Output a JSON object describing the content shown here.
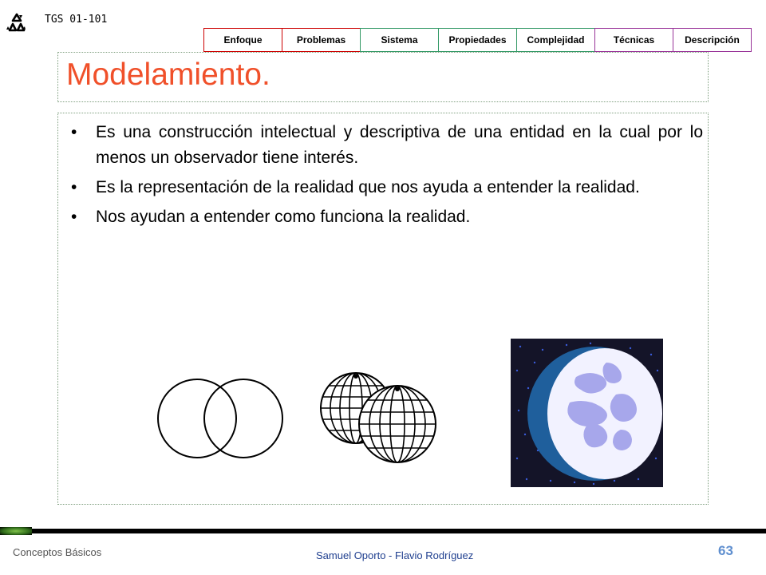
{
  "header": {
    "course": "TGS 01-101",
    "logo_icon": "recycle-icon"
  },
  "nav": {
    "tabs": [
      {
        "label": "Enfoque",
        "color": "#cc0000"
      },
      {
        "label": "Problemas",
        "color": "#cc0000"
      },
      {
        "label": "Sistema",
        "color": "#339966"
      },
      {
        "label": "Propiedades",
        "color": "#339966"
      },
      {
        "label": "Complejidad",
        "color": "#339966"
      },
      {
        "label": "Técnicas",
        "color": "#993399"
      },
      {
        "label": "Descripción",
        "color": "#993399"
      }
    ]
  },
  "slide": {
    "title": "Modelamiento.",
    "title_color": "#f0502a",
    "bullet_char": "•",
    "bullets": [
      "Es una construcción intelectual y descriptiva de una entidad en la cual por lo menos un observador tiene interés.",
      "Es la representación de la realidad que nos ayuda a entender la realidad.",
      "Nos ayudan a entender como funciona la realidad."
    ],
    "images": [
      {
        "name": "venn-circles-illustration"
      },
      {
        "name": "wireframe-spheres-illustration"
      },
      {
        "name": "moon-illustration"
      }
    ]
  },
  "footer": {
    "left": "Conceptos Básicos",
    "center": "Samuel Oporto - Flavio Rodríguez",
    "page": "63"
  }
}
